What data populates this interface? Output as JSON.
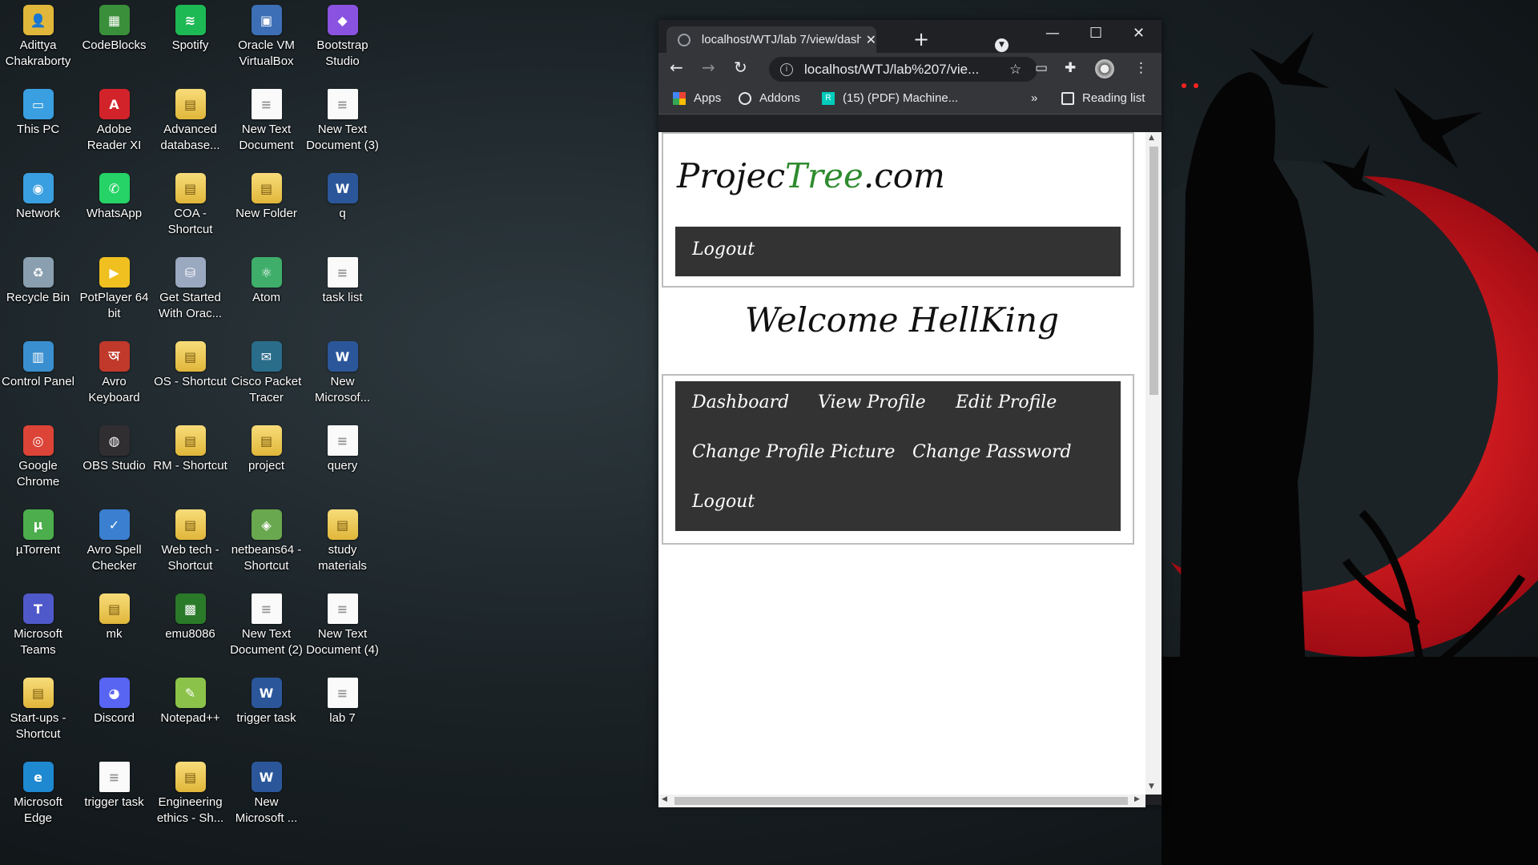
{
  "desktop": {
    "icons": [
      {
        "label": "Adittya\nChakraborty",
        "glyph": "👤",
        "color": "#e0b73a"
      },
      {
        "label": "CodeBlocks",
        "glyph": "▦",
        "color": "#3a8f3a"
      },
      {
        "label": "Spotify",
        "glyph": "≋",
        "color": "#1db954"
      },
      {
        "label": "Oracle VM\nVirtualBox",
        "glyph": "▣",
        "color": "#3d6fb6"
      },
      {
        "label": "Bootstrap\nStudio",
        "glyph": "◆",
        "color": "#8a52e0"
      },
      {
        "label": "This PC",
        "glyph": "▭",
        "color": "#3a9fe0"
      },
      {
        "label": "Adobe\nReader XI",
        "glyph": "A",
        "color": "#d2232a"
      },
      {
        "label": "Advanced\ndatabase...",
        "glyph": "▤",
        "color": "folder"
      },
      {
        "label": "New Text\nDocument",
        "glyph": "≡",
        "color": "doc"
      },
      {
        "label": "New Text\nDocument (3)",
        "glyph": "≡",
        "color": "doc"
      },
      {
        "label": "Network",
        "glyph": "◉",
        "color": "#3a9fe0"
      },
      {
        "label": "WhatsApp",
        "glyph": "✆",
        "color": "#25d366"
      },
      {
        "label": "COA -\nShortcut",
        "glyph": "▤",
        "color": "folder"
      },
      {
        "label": "New Folder",
        "glyph": "▤",
        "color": "folder"
      },
      {
        "label": "q",
        "glyph": "W",
        "color": "word"
      },
      {
        "label": "Recycle Bin",
        "glyph": "♻",
        "color": "#8aa0b0"
      },
      {
        "label": "PotPlayer 64\nbit",
        "glyph": "▶",
        "color": "#f0c020"
      },
      {
        "label": "Get Started\nWith Orac...",
        "glyph": "⛁",
        "color": "#9aa8c0"
      },
      {
        "label": "Atom",
        "glyph": "⚛",
        "color": "#3fae6a"
      },
      {
        "label": "task list",
        "glyph": "≡",
        "color": "doc"
      },
      {
        "label": "Control Panel",
        "glyph": "▥",
        "color": "#3a8fd0"
      },
      {
        "label": "Avro\nKeyboard",
        "glyph": "অ",
        "color": "#c0392b"
      },
      {
        "label": "OS - Shortcut",
        "glyph": "▤",
        "color": "folder"
      },
      {
        "label": "Cisco Packet\nTracer",
        "glyph": "✉",
        "color": "#2a6d8a"
      },
      {
        "label": "New\nMicrosof...",
        "glyph": "W",
        "color": "word"
      },
      {
        "label": "Google\nChrome",
        "glyph": "◎",
        "color": "#db4437"
      },
      {
        "label": "OBS Studio",
        "glyph": "◍",
        "color": "#302e31"
      },
      {
        "label": "RM - Shortcut",
        "glyph": "▤",
        "color": "folder"
      },
      {
        "label": "project",
        "glyph": "▤",
        "color": "folder"
      },
      {
        "label": "query",
        "glyph": "≡",
        "color": "doc"
      },
      {
        "label": "µTorrent",
        "glyph": "µ",
        "color": "#4cae4c"
      },
      {
        "label": "Avro Spell\nChecker",
        "glyph": "✓",
        "color": "#3a7fd0"
      },
      {
        "label": "Web tech -\nShortcut",
        "glyph": "▤",
        "color": "folder"
      },
      {
        "label": "netbeans64 -\nShortcut",
        "glyph": "◈",
        "color": "#6aa84f"
      },
      {
        "label": "study\nmaterials",
        "glyph": "▤",
        "color": "folder"
      },
      {
        "label": "Microsoft\nTeams",
        "glyph": "T",
        "color": "#5059c9"
      },
      {
        "label": "mk",
        "glyph": "▤",
        "color": "folder"
      },
      {
        "label": "emu8086",
        "glyph": "▩",
        "color": "#2a7a2a"
      },
      {
        "label": "New Text\nDocument (2)",
        "glyph": "≡",
        "color": "doc"
      },
      {
        "label": "New Text\nDocument (4)",
        "glyph": "≡",
        "color": "doc"
      },
      {
        "label": "Start-ups -\nShortcut",
        "glyph": "▤",
        "color": "folder"
      },
      {
        "label": "Discord",
        "glyph": "◕",
        "color": "#5865f2"
      },
      {
        "label": "Notepad++",
        "glyph": "✎",
        "color": "#8bc34a"
      },
      {
        "label": "trigger task",
        "glyph": "W",
        "color": "word"
      },
      {
        "label": "lab 7",
        "glyph": "≡",
        "color": "doc"
      },
      {
        "label": "Microsoft\nEdge",
        "glyph": "e",
        "color": "#1e88d0"
      },
      {
        "label": "trigger task",
        "glyph": "≡",
        "color": "doc"
      },
      {
        "label": "Engineering\nethics - Sh...",
        "glyph": "▤",
        "color": "folder"
      },
      {
        "label": "New\nMicrosoft ...",
        "glyph": "W",
        "color": "word"
      }
    ]
  },
  "browser": {
    "tab_title": "localhost/WTJ/lab 7/view/dashb",
    "url": "localhost/WTJ/lab%207/vie...",
    "bookmarks": {
      "apps": "Apps",
      "addons": "Addons",
      "pdf": "(15) (PDF) Machine...",
      "more": "»",
      "reading_list": "Reading list"
    }
  },
  "page": {
    "logo_prefix": "Projec",
    "logo_tree": "Tree",
    "logo_suffix": ".com",
    "header_logout": "Logout",
    "welcome": "Welcome HellKing",
    "menu": {
      "dashboard": "Dashboard",
      "view_profile": "View Profile",
      "edit_profile": "Edit Profile",
      "change_picture": "Change Profile Picture",
      "change_password": "Change Password",
      "logout": "Logout"
    }
  },
  "colors": {
    "nav_bg": "#333333",
    "logo_accent": "#2e8b2e",
    "wallpaper_moon": "#c0141c"
  }
}
